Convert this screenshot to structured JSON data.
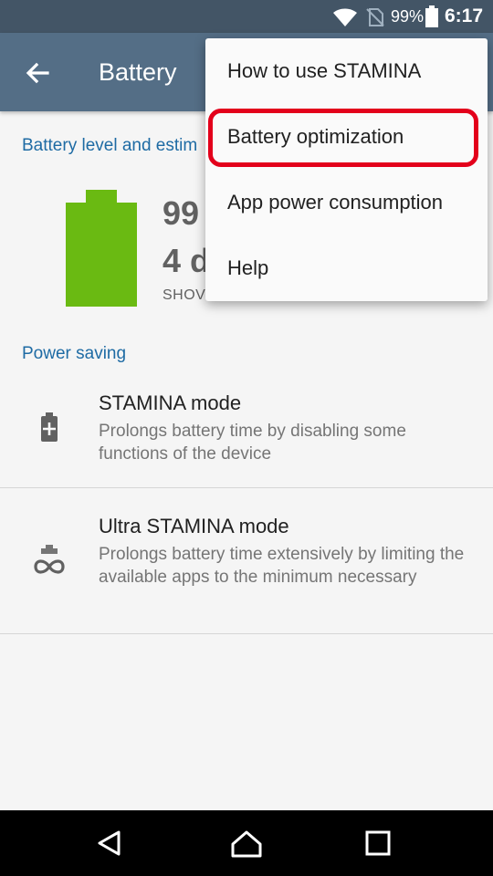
{
  "status_bar": {
    "battery_percent": "99%",
    "time": "6:17",
    "icons": [
      "wifi-icon",
      "no-sim-icon",
      "battery-icon"
    ]
  },
  "app_bar": {
    "title": "Battery",
    "back_icon": "arrow-back-icon"
  },
  "battery_section": {
    "header": "Battery level and estim",
    "level_value": "99",
    "estimate_value": "4 d",
    "show_link": "SHOV",
    "battery_color": "#6aba12"
  },
  "power_saving": {
    "header": "Power saving",
    "items": [
      {
        "title": "STAMINA mode",
        "description": "Prolongs battery time by disabling some functions of the device",
        "icon": "battery-plus-icon"
      },
      {
        "title": "Ultra STAMINA mode",
        "description": "Prolongs battery time extensively by limiting the available apps to the minimum necessary",
        "icon": "battery-infinity-icon"
      }
    ]
  },
  "overflow_menu": {
    "items": [
      {
        "label": "How to use STAMINA"
      },
      {
        "label": "Battery optimization",
        "highlighted": true
      },
      {
        "label": "App power consumption"
      },
      {
        "label": "Help"
      }
    ],
    "highlight_color": "#e3001b"
  },
  "nav_bar": {
    "icons": [
      "back-triangle-icon",
      "home-icon",
      "recents-icon"
    ]
  },
  "colors": {
    "status_bar": "#435566",
    "app_bar": "#546e86",
    "accent": "#1e6ba4"
  }
}
